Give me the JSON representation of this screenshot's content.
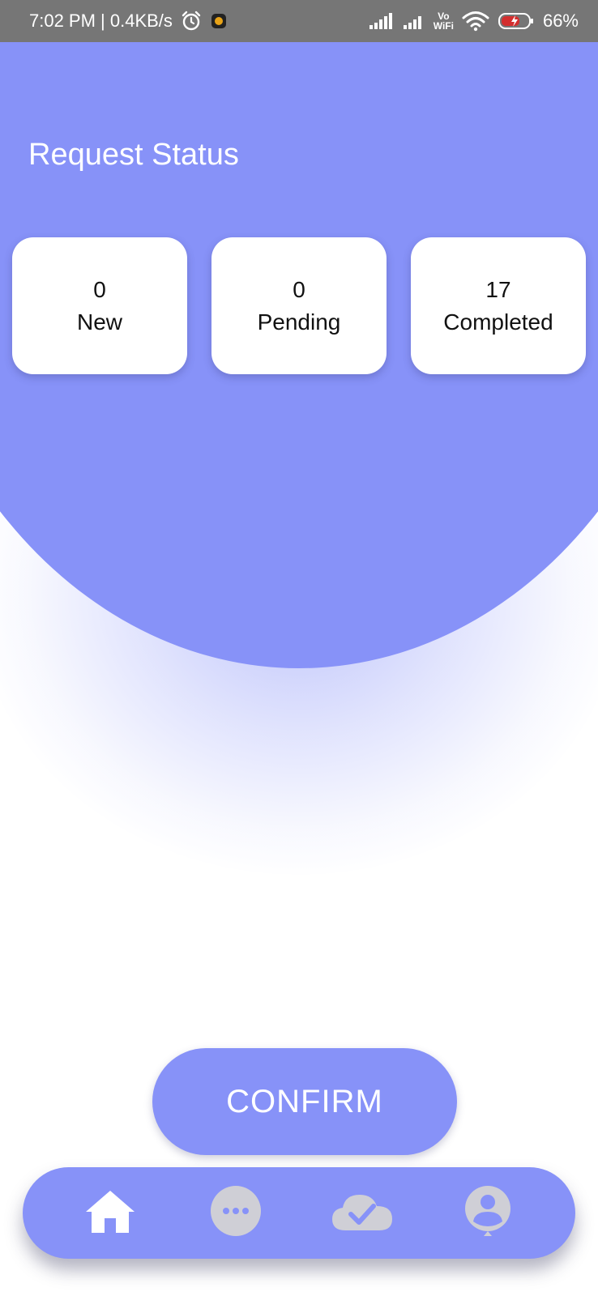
{
  "status_bar": {
    "time_speed": "7:02 PM | 0.4KB/s",
    "vowifi_top": "Vo",
    "vowifi_bottom": "WiFi",
    "battery": "66%"
  },
  "header": {
    "title": "Request Status"
  },
  "cards": [
    {
      "count": "0",
      "label": "New"
    },
    {
      "count": "0",
      "label": "Pending"
    },
    {
      "count": "17",
      "label": "Completed"
    }
  ],
  "confirm": {
    "label": "CONFIRM"
  },
  "nav": {
    "items": [
      {
        "icon": "home-icon",
        "active": true
      },
      {
        "icon": "more-dots-icon",
        "active": false
      },
      {
        "icon": "cloud-check-icon",
        "active": false
      },
      {
        "icon": "profile-icon",
        "active": false
      }
    ]
  },
  "colors": {
    "primary": "#8792f8",
    "status_bar": "#767676",
    "icon_inactive": "#cfcfd6",
    "battery_low": "#d32f2f"
  }
}
